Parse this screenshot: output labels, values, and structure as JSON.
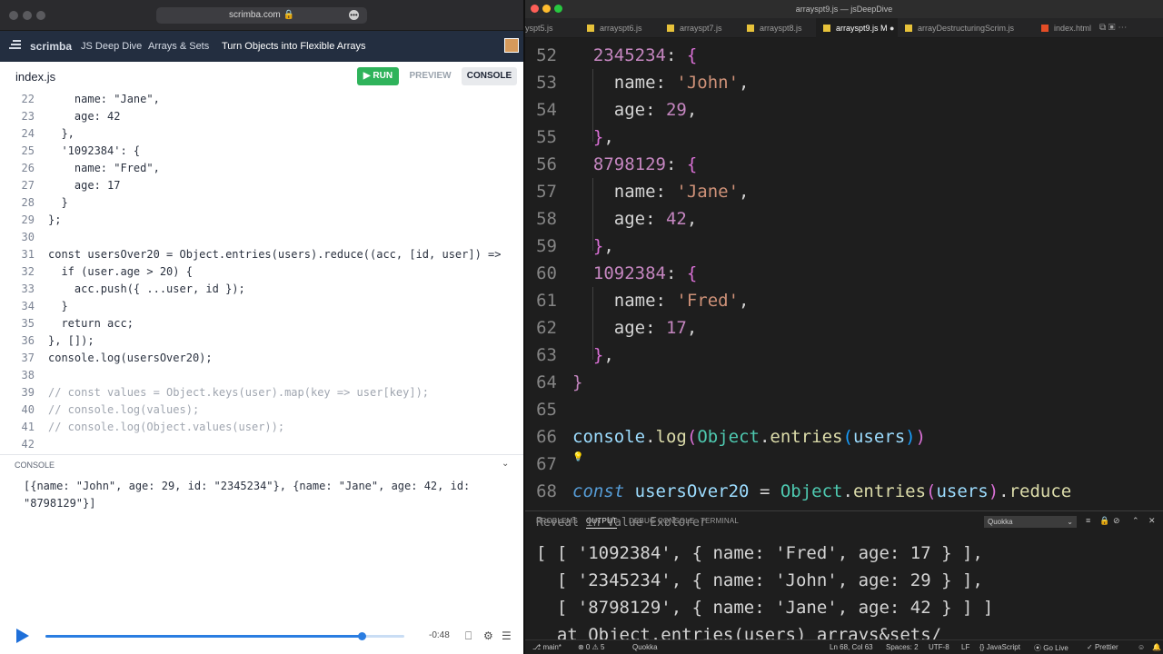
{
  "browser": {
    "url": "scrimba.com"
  },
  "scrimba": {
    "logo": "scrimba",
    "breadcrumbs": [
      "JS Deep Dive",
      "Arrays & Sets",
      "Turn Objects into Flexible Arrays"
    ],
    "file_name": "index.js",
    "run_label": "RUN",
    "preview_label": "PREVIEW",
    "console_label": "CONSOLE",
    "code_lines": [
      {
        "n": "22",
        "t": "    name: \"Jane\","
      },
      {
        "n": "23",
        "t": "    age: 42"
      },
      {
        "n": "24",
        "t": "  },"
      },
      {
        "n": "25",
        "t": "  '1092384': {"
      },
      {
        "n": "26",
        "t": "    name: \"Fred\","
      },
      {
        "n": "27",
        "t": "    age: 17"
      },
      {
        "n": "28",
        "t": "  }"
      },
      {
        "n": "29",
        "t": "};"
      },
      {
        "n": "30",
        "t": ""
      },
      {
        "n": "31",
        "t": "const usersOver20 = Object.entries(users).reduce((acc, [id, user]) =>"
      },
      {
        "n": "32",
        "t": "  if (user.age > 20) {"
      },
      {
        "n": "33",
        "t": "    acc.push({ ...user, id });"
      },
      {
        "n": "34",
        "t": "  }"
      },
      {
        "n": "35",
        "t": "  return acc;"
      },
      {
        "n": "36",
        "t": "}, []);"
      },
      {
        "n": "37",
        "t": "console.log(usersOver20);"
      },
      {
        "n": "38",
        "t": ""
      },
      {
        "n": "39",
        "t": "// const values = Object.keys(user).map(key => user[key]);"
      },
      {
        "n": "40",
        "t": "// console.log(values);"
      },
      {
        "n": "41",
        "t": "// console.log(Object.values(user));"
      },
      {
        "n": "42",
        "t": ""
      }
    ],
    "console_header": "CONSOLE",
    "console_output": "[{name: \"John\", age: 29, id: \"2345234\"}, {name: \"Jane\", age: 42, id: \"8798129\"}]",
    "player": {
      "time_remaining": "-0:48",
      "progress": 0.88,
      "marker": 0.34
    }
  },
  "vscode": {
    "window_title": "arrayspt9.js — jsDeepDive",
    "tabs": [
      {
        "label": "yspt5.js"
      },
      {
        "label": "arrayspt6.js"
      },
      {
        "label": "arrayspt7.js"
      },
      {
        "label": "arrayspt8.js"
      },
      {
        "label": "arrayspt9.js M",
        "active": true
      },
      {
        "label": "arrayDestructuringScrim.js"
      },
      {
        "label": "index.html"
      }
    ],
    "panel_tabs": [
      "PROBLEMS",
      "OUTPUT",
      "DEBUG CONSOLE",
      "TERMINAL"
    ],
    "panel_active": "OUTPUT",
    "output_channel": "Quokka",
    "output_lines": [
      "[ [ '1092384', { name: 'Fred', age: 17 } ],",
      "  [ '2345234', { name: 'John', age: 29 } ],",
      "  [ '8798129', { name: 'Jane', age: 42 } ] ]",
      "  at Object.entries(users) arrays&sets/"
    ],
    "output_partial_top": "Reveal in Value Explorer",
    "status": {
      "branch": "main*",
      "problems": "⊗ 0 ⚠ 5",
      "quokka": "Quokka",
      "position": "Ln 68, Col 63",
      "spaces": "Spaces: 2",
      "encoding": "UTF-8",
      "eol": "LF",
      "language": "JavaScript",
      "golive": "Go Live",
      "prettier": "Prettier"
    }
  },
  "colors": {
    "run_green": "#2fb35b",
    "scrimba_nav": "#232e40",
    "player_blue": "#2a7de1"
  }
}
